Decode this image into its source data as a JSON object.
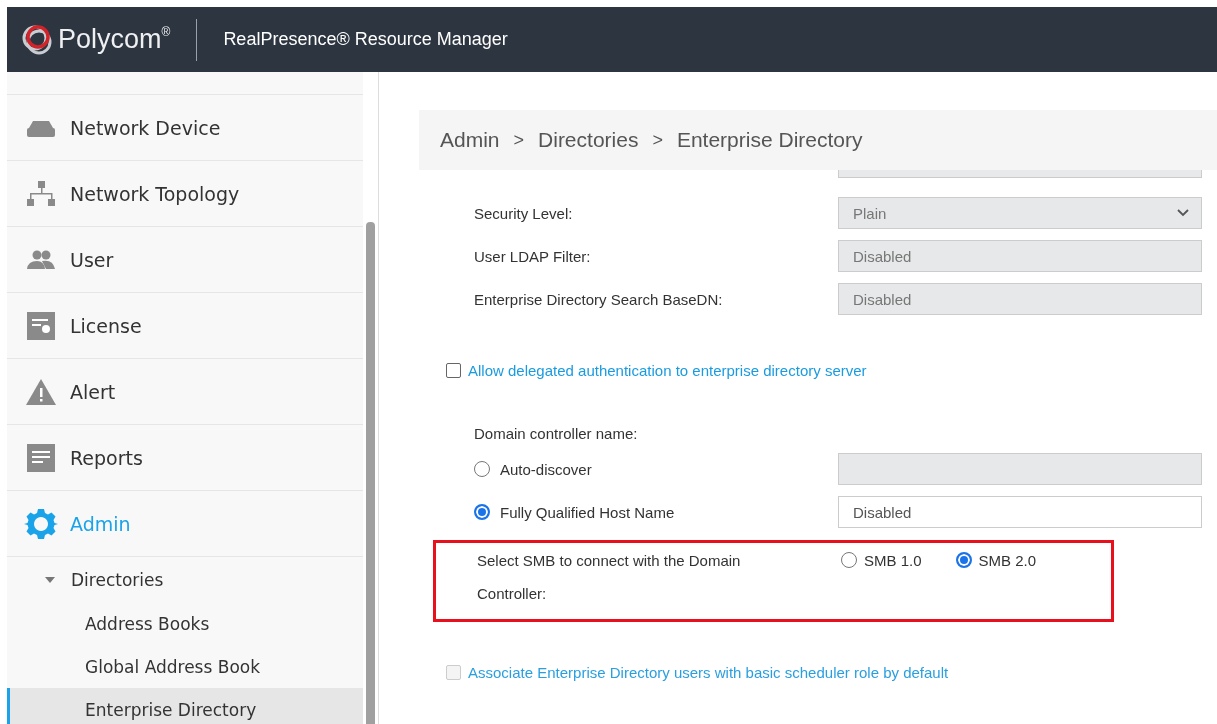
{
  "header": {
    "brand": "Polycom",
    "brand_mark": "®",
    "product": "RealPresence® Resource Manager"
  },
  "sidebar": {
    "items": [
      {
        "label": "Network Device",
        "kind": "device",
        "selected": false
      },
      {
        "label": "Network Topology",
        "kind": "topology",
        "selected": false
      },
      {
        "label": "User",
        "kind": "users",
        "selected": false
      },
      {
        "label": "License",
        "kind": "license",
        "selected": false
      },
      {
        "label": "Alert",
        "kind": "alert",
        "selected": false
      },
      {
        "label": "Reports",
        "kind": "reports",
        "selected": false
      },
      {
        "label": "Admin",
        "kind": "gear",
        "selected": true
      }
    ],
    "submenu": {
      "label": "Directories",
      "expanded": true,
      "children": [
        {
          "label": "Address Books",
          "selected": false
        },
        {
          "label": "Global Address Book",
          "selected": false
        },
        {
          "label": "Enterprise Directory",
          "selected": true
        }
      ]
    }
  },
  "breadcrumb": [
    {
      "kind": "link",
      "text": "Admin"
    },
    {
      "kind": "sep",
      "text": ">"
    },
    {
      "kind": "link",
      "text": "Directories"
    },
    {
      "kind": "sep",
      "text": ">"
    },
    {
      "kind": "current",
      "text": "Enterprise Directory"
    }
  ],
  "fields": [
    {
      "label": "Security Level:",
      "kind": "select",
      "value": "Plain",
      "disabled": true
    },
    {
      "label": "User LDAP Filter:",
      "kind": "text",
      "value": "Disabled",
      "disabled": true
    },
    {
      "label": "Enterprise Directory Search BaseDN:",
      "kind": "text",
      "value": "Disabled",
      "disabled": true
    }
  ],
  "delegated": {
    "label": "Allow delegated authentication to enterprise directory server",
    "checked": false,
    "disabled": false
  },
  "domain": {
    "label": "Domain controller name:",
    "options": [
      {
        "label": "Auto-discover",
        "selected": false,
        "field_disabled": true
      },
      {
        "label": "Fully Qualified Host Name",
        "selected": true,
        "field_disabled": false,
        "field_value": "Disabled"
      }
    ]
  },
  "smb": {
    "label": "Select SMB to connect with the Domain Controller:",
    "highlighted": true,
    "options": [
      {
        "label": "SMB 1.0",
        "selected": false
      },
      {
        "label": "SMB 2.0",
        "selected": true
      }
    ]
  },
  "associate": {
    "label": "Associate Enterprise Directory users with basic scheduler role by default",
    "checked": false,
    "disabled": true
  }
}
